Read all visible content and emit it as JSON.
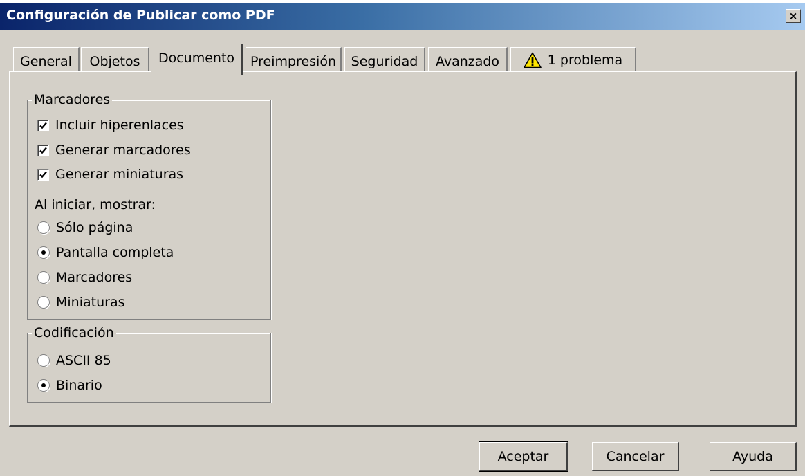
{
  "window": {
    "title": "Configuración de Publicar como PDF",
    "close_label": "×"
  },
  "tabs": [
    {
      "label": "General"
    },
    {
      "label": "Objetos"
    },
    {
      "label": "Documento",
      "active": true
    },
    {
      "label": "Preimpresión"
    },
    {
      "label": "Seguridad"
    },
    {
      "label": "Avanzado"
    },
    {
      "label": "1 problema",
      "icon": "warning-icon"
    }
  ],
  "bookmarks_group": {
    "legend": "Marcadores",
    "checkboxes": [
      {
        "label": "Incluir hiperenlaces",
        "checked": true
      },
      {
        "label": "Generar marcadores",
        "checked": true
      },
      {
        "label": "Generar miniaturas",
        "checked": true
      }
    ],
    "startup_label": "Al iniciar, mostrar:",
    "startup_options": [
      {
        "label": "Sólo página",
        "selected": false
      },
      {
        "label": "Pantalla completa",
        "selected": true
      },
      {
        "label": "Marcadores",
        "selected": false
      },
      {
        "label": "Miniaturas",
        "selected": false
      }
    ]
  },
  "encoding_group": {
    "legend": "Codificación",
    "options": [
      {
        "label": "ASCII 85",
        "selected": false
      },
      {
        "label": "Binario",
        "selected": true
      }
    ]
  },
  "buttons": {
    "ok": "Aceptar",
    "cancel": "Cancelar",
    "help": "Ayuda"
  },
  "colors": {
    "dialog_face": "#d4d0c8",
    "title_start": "#0a246a",
    "title_end": "#a6caf0",
    "warning_yellow": "#ffe600"
  }
}
